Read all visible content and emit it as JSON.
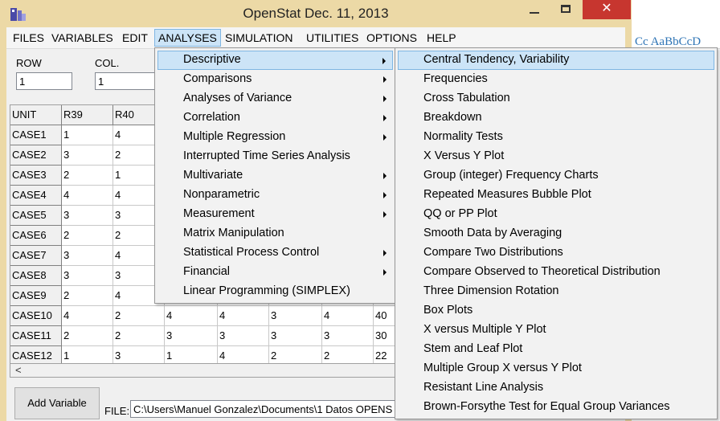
{
  "window": {
    "title": "OpenStat Dec. 11, 2013",
    "close_glyph": "✕"
  },
  "menubar": [
    "FILES",
    "VARIABLES",
    "EDIT",
    "ANALYSES",
    "SIMULATION",
    "UTILITIES",
    "OPTIONS",
    "HELP"
  ],
  "active_menu": "ANALYSES",
  "fields": {
    "row_label": "ROW",
    "row_value": "1",
    "col_label": "COL.",
    "col_value": "1"
  },
  "grid": {
    "headers": [
      "UNIT",
      "R39",
      "R40",
      "",
      "",
      "",
      "",
      ""
    ],
    "rows": [
      [
        "CASE1",
        "1",
        "4",
        "",
        "",
        "",
        "",
        ""
      ],
      [
        "CASE2",
        "3",
        "2",
        "",
        "",
        "",
        "",
        ""
      ],
      [
        "CASE3",
        "2",
        "1",
        "",
        "",
        "",
        "",
        ""
      ],
      [
        "CASE4",
        "4",
        "4",
        "",
        "",
        "",
        "",
        ""
      ],
      [
        "CASE5",
        "3",
        "3",
        "",
        "",
        "",
        "",
        ""
      ],
      [
        "CASE6",
        "2",
        "2",
        "",
        "",
        "",
        "",
        ""
      ],
      [
        "CASE7",
        "3",
        "4",
        "",
        "",
        "",
        "",
        ""
      ],
      [
        "CASE8",
        "3",
        "3",
        "",
        "",
        "",
        "",
        ""
      ],
      [
        "CASE9",
        "2",
        "4",
        "",
        "",
        "",
        "",
        ""
      ],
      [
        "CASE10",
        "4",
        "2",
        "4",
        "4",
        "3",
        "4",
        "40"
      ],
      [
        "CASE11",
        "2",
        "2",
        "3",
        "3",
        "3",
        "3",
        "30"
      ],
      [
        "CASE12",
        "1",
        "3",
        "1",
        "4",
        "2",
        "2",
        "22"
      ]
    ],
    "scroll_left_glyph": "<"
  },
  "bottom": {
    "add_variable_label": "Add Variable",
    "file_label": "FILE:",
    "file_path": "C:\\Users\\Manuel Gonzalez\\Documents\\1 Datos OPENS"
  },
  "analyses_menu": [
    {
      "label": "Descriptive",
      "submenu": true
    },
    {
      "label": "Comparisons",
      "submenu": true
    },
    {
      "label": "Analyses of Variance",
      "submenu": true
    },
    {
      "label": "Correlation",
      "submenu": true
    },
    {
      "label": "Multiple Regression",
      "submenu": true
    },
    {
      "label": "Interrupted Time Series Analysis",
      "submenu": false
    },
    {
      "label": "Multivariate",
      "submenu": true
    },
    {
      "label": "Nonparametric",
      "submenu": true
    },
    {
      "label": "Measurement",
      "submenu": true
    },
    {
      "label": "Matrix Manipulation",
      "submenu": false
    },
    {
      "label": "Statistical Process Control",
      "submenu": true
    },
    {
      "label": "Financial",
      "submenu": true
    },
    {
      "label": "Linear Programming (SIMPLEX)",
      "submenu": false
    }
  ],
  "descriptive_menu": [
    "Central Tendency, Variability",
    "Frequencies",
    "Cross Tabulation",
    "Breakdown",
    "Normality Tests",
    "X Versus Y Plot",
    "Group (integer) Frequency Charts",
    "Repeated Measures Bubble Plot",
    "QQ or PP Plot",
    "Smooth Data by Averaging",
    "Compare Two Distributions",
    "Compare Observed to Theoretical Distribution",
    "Three Dimension Rotation",
    "Box Plots",
    "X versus Multiple Y Plot",
    "Stem and Leaf Plot",
    "Multiple Group X versus Y Plot",
    "Resistant Line Analysis",
    "Brown-Forsythe Test for Equal Group Variances"
  ],
  "background_doc": {
    "styles_text": "Cc  AaBbCcD"
  },
  "colors": {
    "frame": "#ecd9a6",
    "close": "#c7362f",
    "highlight": "#cce4f7",
    "highlight_border": "#7fb6e3"
  }
}
